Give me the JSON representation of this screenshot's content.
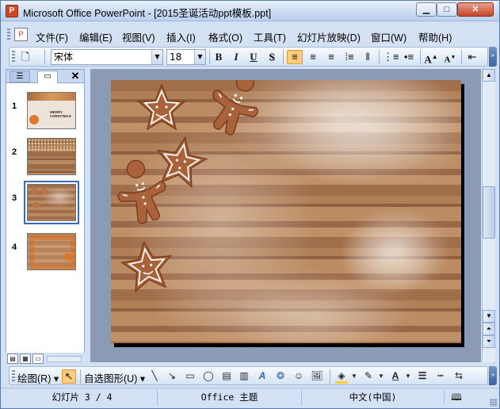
{
  "window": {
    "title": "Microsoft Office PowerPoint - [2015圣诞活动ppt模板.ppt]",
    "app_icon_letter": "P",
    "minimize_glyph": "▁",
    "maximize_glyph": "□",
    "close_glyph": "✕"
  },
  "menu": {
    "items": [
      {
        "label": "文件(F)"
      },
      {
        "label": "编辑(E)"
      },
      {
        "label": "视图(V)"
      },
      {
        "label": "插入(I)"
      },
      {
        "label": "格式(O)"
      },
      {
        "label": "工具(T)"
      },
      {
        "label": "幻灯片放映(D)"
      },
      {
        "label": "窗口(W)"
      },
      {
        "label": "帮助(H)"
      }
    ]
  },
  "toolbar": {
    "font_name": "宋体",
    "font_size": "18",
    "bold": "B",
    "italic": "I",
    "underline": "U",
    "shadow": "S",
    "grow": "A",
    "shrink": "A"
  },
  "slides_pane": {
    "slides": [
      {
        "number": "1",
        "caption": "MERRY CHRISTMAS"
      },
      {
        "number": "2"
      },
      {
        "number": "3"
      },
      {
        "number": "4"
      }
    ],
    "selected": "3"
  },
  "draw_toolbar": {
    "draw_label": "绘图(R)",
    "autoshapes_label": "自选图形(U)"
  },
  "status": {
    "slide": "幻灯片 3 / 4",
    "theme": "Office 主题",
    "language": "中文(中国)"
  },
  "colors": {
    "accent": "#ffcd7a",
    "chrome": "#d4e1f4",
    "workspace": "#8c9bb5",
    "selection": "#3b6bb8"
  }
}
